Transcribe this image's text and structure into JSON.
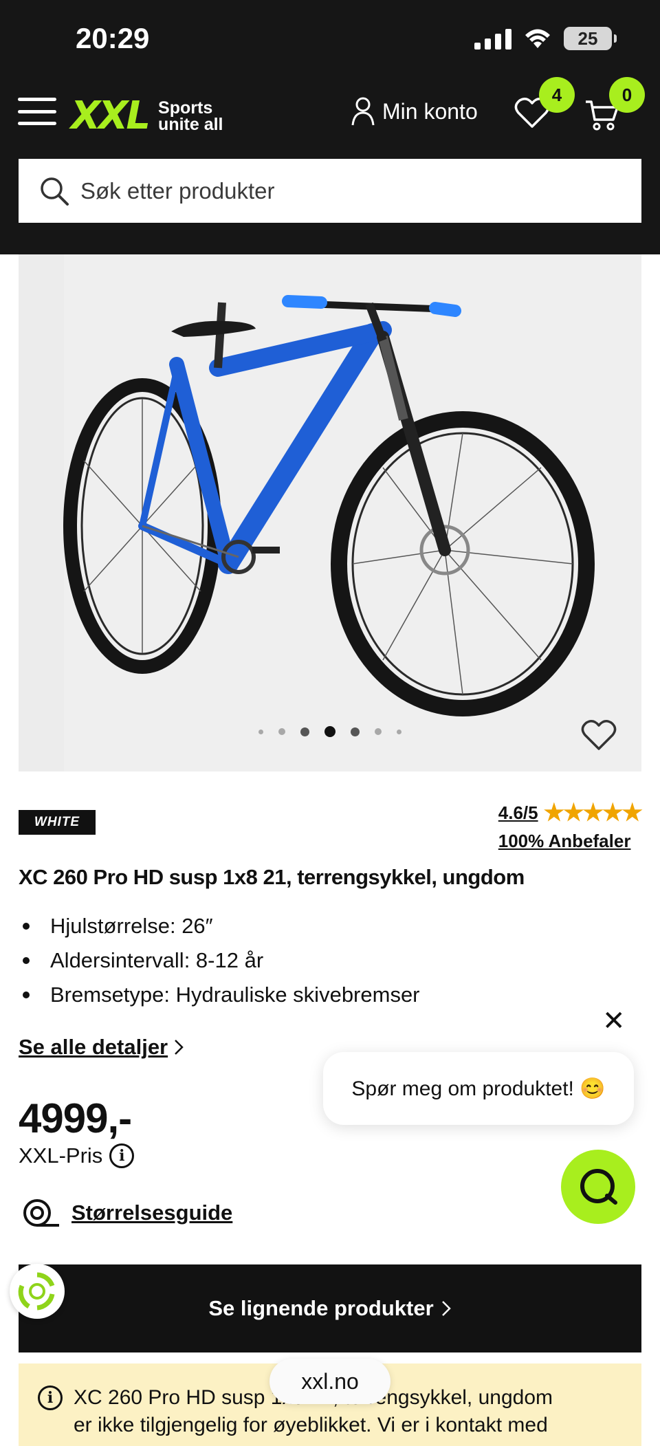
{
  "status_bar": {
    "time": "20:29",
    "battery": "25"
  },
  "header": {
    "logo_text": "XXL",
    "logo_tagline_1": "Sports",
    "logo_tagline_2": "unite all",
    "account_label": "Min konto",
    "wishlist_count": "4",
    "cart_count": "0",
    "brand_color": "#a8ee1e"
  },
  "search": {
    "placeholder": "Søk etter produkter"
  },
  "gallery": {
    "total_images": 7,
    "active_index": 3
  },
  "product": {
    "brand": "WHITE",
    "rating": "4.6/5",
    "rating_value": 4.6,
    "recommend": "100% Anbefaler",
    "title": "XC 260 Pro HD susp 1x8 21, terrengsykkel, ungdom",
    "features": [
      "Hjulstørrelse: 26″",
      "Aldersintervall: 8-12 år",
      "Bremsetype: Hydrauliske skivebremser"
    ],
    "details_link": "Se alle detaljer",
    "price": "4999,-",
    "price_label": "XXL-Pris",
    "size_guide": "Størrelsesguide"
  },
  "chat": {
    "bubble_text": "Spør meg om produktet! 😊"
  },
  "similar_button": "Se lignende produkter",
  "notice": {
    "line1": "XC 260 Pro HD susp 1x8 21, terrengsykkel, ungdom",
    "line2": "er ikke tilgjengelig for øyeblikket. Vi er i kontakt med"
  },
  "browser": {
    "url": "xxl.no"
  }
}
